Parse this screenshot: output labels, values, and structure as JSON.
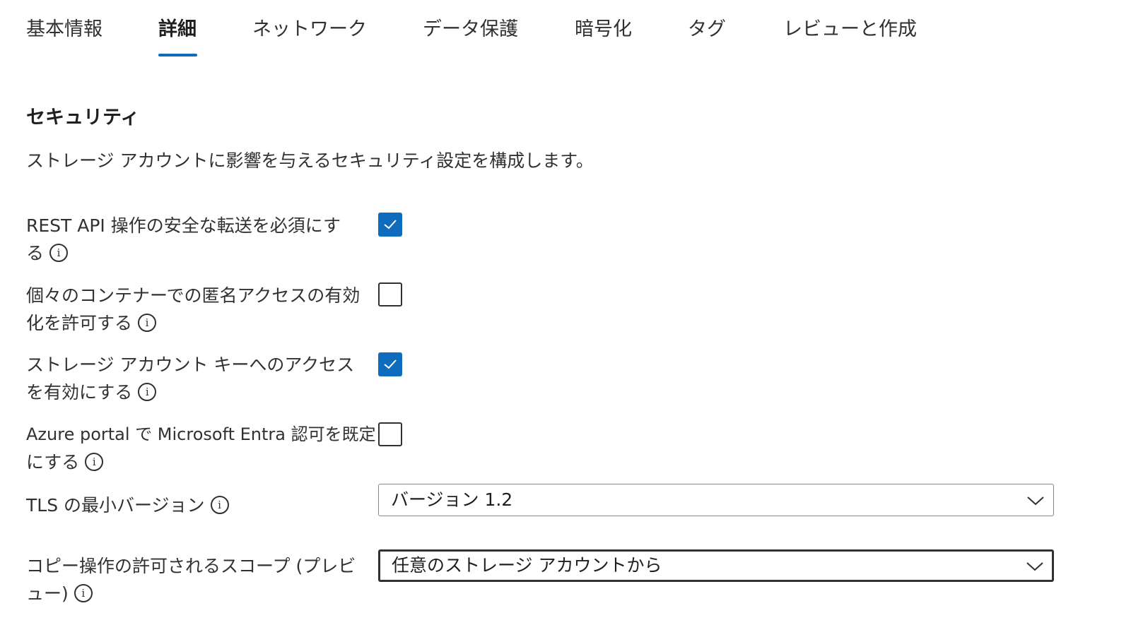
{
  "tabs": [
    {
      "label": "基本情報",
      "active": false
    },
    {
      "label": "詳細",
      "active": true
    },
    {
      "label": "ネットワーク",
      "active": false
    },
    {
      "label": "データ保護",
      "active": false
    },
    {
      "label": "暗号化",
      "active": false
    },
    {
      "label": "タグ",
      "active": false
    },
    {
      "label": "レビューと作成",
      "active": false
    }
  ],
  "section": {
    "title": "セキュリティ",
    "description": "ストレージ アカウントに影響を与えるセキュリティ設定を構成します。"
  },
  "settings": [
    {
      "line1": "REST API 操作の安全な転送を必須にす",
      "line2": "る",
      "checked": true
    },
    {
      "line1": "個々のコンテナーでの匿名アクセスの有効",
      "line2": "化を許可する",
      "checked": false
    },
    {
      "line1": "ストレージ アカウント キーへのアクセス",
      "line2": "を有効にする",
      "checked": true
    },
    {
      "line1": "Azure portal で Microsoft Entra 認可を既定",
      "line2": "にする",
      "checked": false
    }
  ],
  "tls": {
    "label": "TLS の最小バージョン",
    "value": "バージョン 1.2"
  },
  "copy_scope": {
    "line1": "コピー操作の許可されるスコープ (プレビ",
    "line2": "ュー)",
    "value": "任意のストレージ アカウントから"
  },
  "icons": {
    "info": "i"
  },
  "colors": {
    "accent": "#0f6cbd",
    "text": "#323130",
    "border": "#8a8886"
  }
}
